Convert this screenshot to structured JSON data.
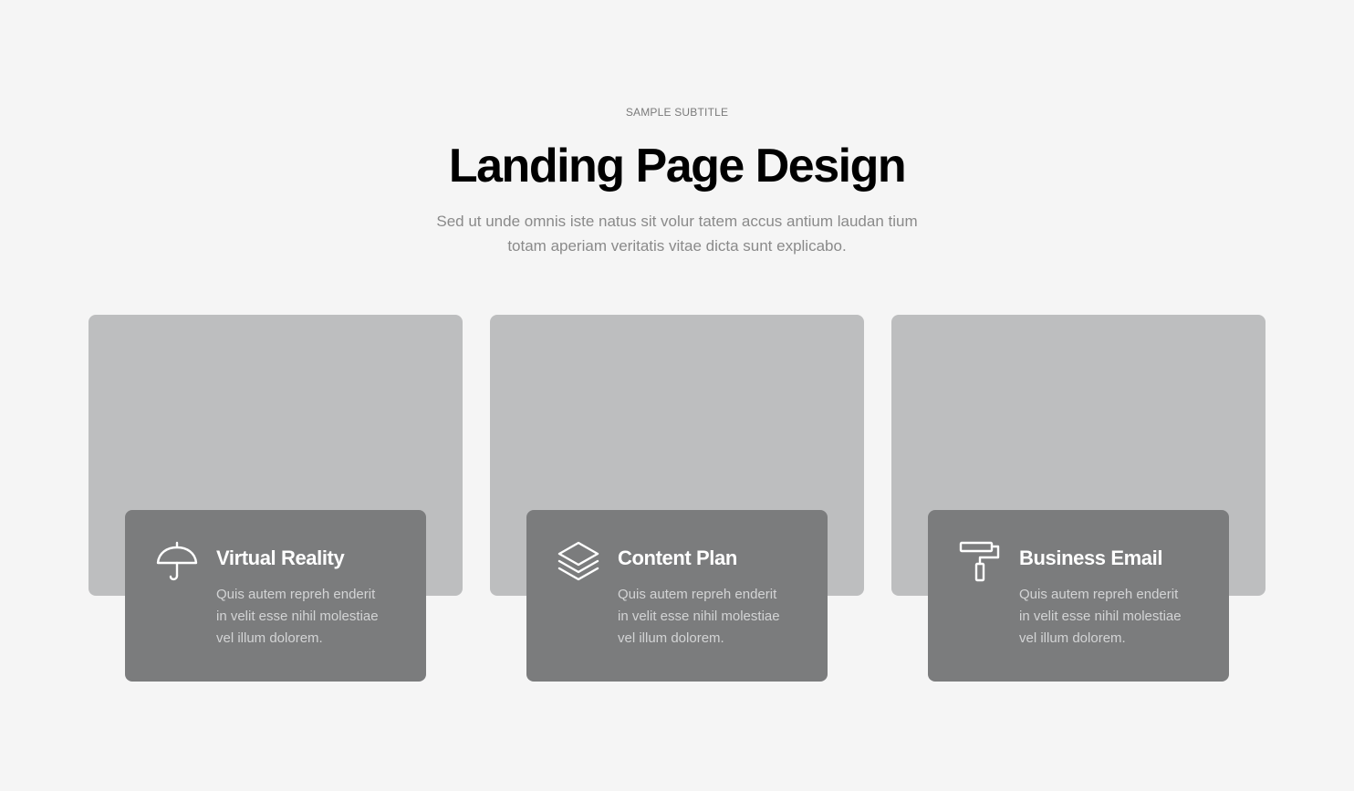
{
  "header": {
    "subtitle": "SAMPLE SUBTITLE",
    "title": "Landing Page Design",
    "lead_line1": "Sed ut unde omnis iste natus sit volur tatem accus antium laudan tium",
    "lead_line2": "totam aperiam veritatis vitae dicta sunt explicabo."
  },
  "features": [
    {
      "icon": "umbrella-icon",
      "title": "Virtual Reality",
      "desc_line1": "Quis autem repreh enderit",
      "desc_line2": "in velit esse nihil molestiae",
      "desc_line3": "vel illum dolorem."
    },
    {
      "icon": "layers-icon",
      "title": "Content Plan",
      "desc_line1": "Quis autem repreh enderit",
      "desc_line2": "in velit esse nihil molestiae",
      "desc_line3": "vel illum dolorem."
    },
    {
      "icon": "paint-roller-icon",
      "title": "Business Email",
      "desc_line1": "Quis autem repreh enderit",
      "desc_line2": "in velit esse nihil molestiae",
      "desc_line3": "vel illum dolorem."
    }
  ],
  "colors": {
    "background": "#f5f5f5",
    "image_placeholder": "#bdbebf",
    "info_card": "#7b7c7d",
    "heading_text": "#000000",
    "muted_text": "#8a8a8a"
  }
}
